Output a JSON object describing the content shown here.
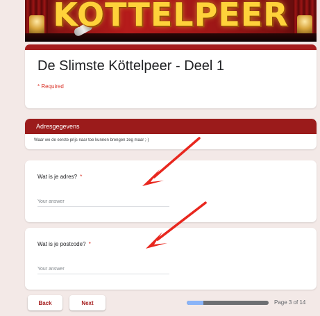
{
  "banner": {
    "title": "KOTTELPEER"
  },
  "form": {
    "title": "De Slimste Köttelpeer - Deel 1",
    "required_note": "* Required"
  },
  "section": {
    "title": "Adresgegevens",
    "description": "Waar we de eerste prijs naar toe kunnen brengen zeg maar ;-)"
  },
  "questions": [
    {
      "label": "Wat is je adres?",
      "required_mark": "*",
      "placeholder": "Your answer"
    },
    {
      "label": "Wat is je postcode?",
      "required_mark": "*",
      "placeholder": "Your answer"
    }
  ],
  "nav": {
    "back_label": "Back",
    "next_label": "Next",
    "page_indicator": "Page 3 of 14",
    "progress_fraction": 0.2
  },
  "colors": {
    "accent": "#a51d1d",
    "section_header": "#9b1b1b",
    "required": "#d93025",
    "background": "#f3e9e7",
    "progress_fill": "#8ab4f8",
    "annotation_arrow": "#e8271e"
  },
  "icons": {
    "annotation": "red-arrow-icon"
  }
}
